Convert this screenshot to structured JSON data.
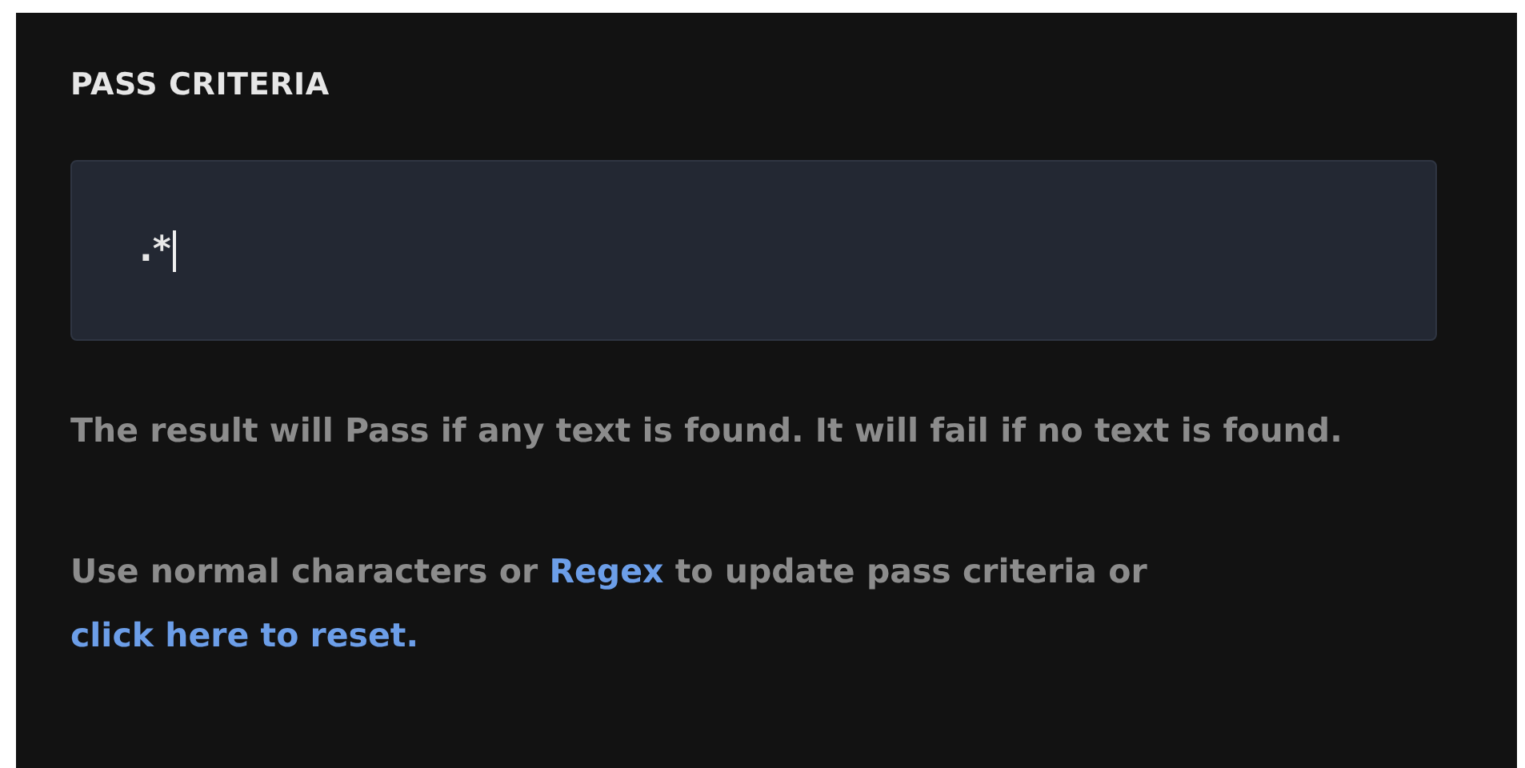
{
  "section": {
    "title": "PASS CRITERIA"
  },
  "criteria_field": {
    "value": ".*",
    "focused": true
  },
  "description": "The result will Pass if any text is found. It will fail if no text is found.",
  "hint": [
    {
      "kind": "text",
      "text": "Use normal characters or "
    },
    {
      "kind": "link",
      "text": "Regex"
    },
    {
      "kind": "text",
      "text": " to update pass criteria or "
    },
    {
      "kind": "link",
      "text": "click here to reset."
    }
  ]
}
